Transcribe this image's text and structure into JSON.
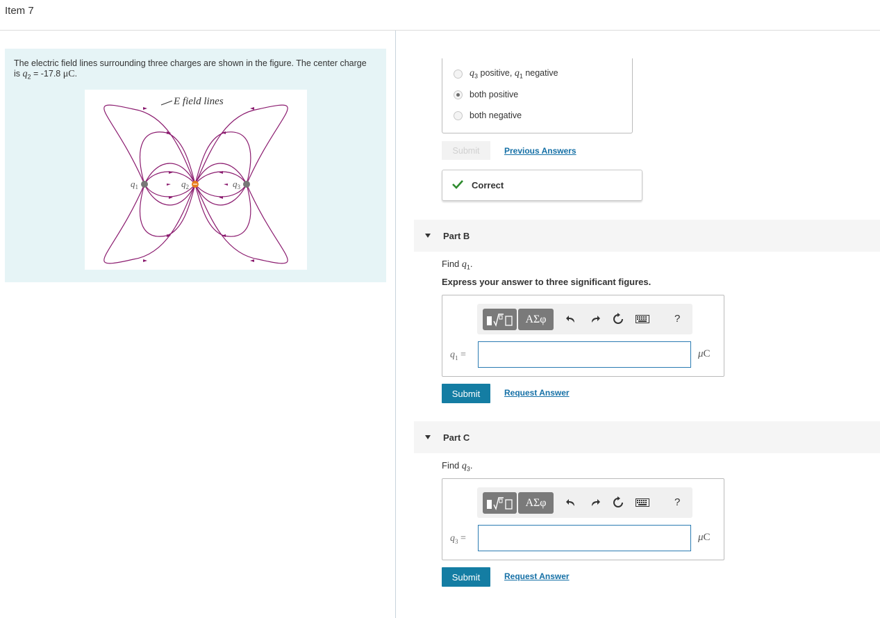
{
  "item": {
    "title": "Item 7"
  },
  "problem": {
    "text_intro": "The electric field lines surrounding three charges are shown in the figure. The center charge is ",
    "q2_var": "q",
    "q2_sub": "2",
    "q2_value": " = -17.8 ",
    "q2_unit": "μC",
    "text_end": ".",
    "figure": {
      "label": "E field lines",
      "charges": [
        {
          "var": "q",
          "sub": "1"
        },
        {
          "var": "q",
          "sub": "2"
        },
        {
          "var": "q",
          "sub": "3"
        }
      ],
      "colors": {
        "lines": "#8a1a6e",
        "center_charge": "#e87e1e",
        "outer_charge": "#777777"
      }
    }
  },
  "part_a": {
    "options": [
      {
        "var1": "q",
        "sub1": "3",
        "text1": " positive, ",
        "var2": "q",
        "sub2": "1",
        "text2": " negative",
        "checked": false
      },
      {
        "label": "both positive",
        "checked": true
      },
      {
        "label": "both negative",
        "checked": false
      }
    ],
    "submit_label": "Submit",
    "previous_answers_label": "Previous Answers",
    "feedback": "Correct"
  },
  "part_b": {
    "header": "Part B",
    "prompt_prefix": "Find ",
    "var": "q",
    "sub": "1",
    "prompt_suffix": ".",
    "instruction": "Express your answer to three significant figures.",
    "toolbar": {
      "greek_label": "ΑΣφ",
      "help_label": "?"
    },
    "eq_var": "q",
    "eq_sub": "1",
    "eq_sign": " =",
    "input_value": "",
    "unit_mu": "μ",
    "unit_c": "C",
    "submit_label": "Submit",
    "request_label": "Request Answer"
  },
  "part_c": {
    "header": "Part C",
    "prompt_prefix": "Find ",
    "var": "q",
    "sub": "3",
    "prompt_suffix": ".",
    "toolbar": {
      "greek_label": "ΑΣφ",
      "help_label": "?"
    },
    "eq_var": "q",
    "eq_sub": "3",
    "eq_sign": " =",
    "input_value": "",
    "unit_mu": "μ",
    "unit_c": "C",
    "submit_label": "Submit",
    "request_label": "Request Answer"
  },
  "colors": {
    "accent": "#147da3",
    "link": "#1570a6",
    "panel_bg": "#e6f4f6",
    "check": "#2e8b2e"
  }
}
